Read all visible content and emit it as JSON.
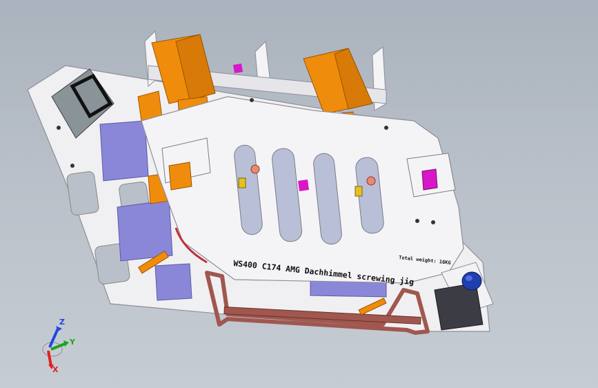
{
  "viewport": {
    "background_top": "#aab2bd",
    "background_bottom": "#c6ccd3"
  },
  "model": {
    "engraving_title": "WS400 C174 AMG Dachhimmel screwing jig",
    "engraving_weight": "Total weight: 16KG",
    "colors": {
      "plate": "#f2f2f4",
      "plate_edge": "#9a9aa6",
      "pads": "#f08c0c",
      "blocks": "#8b87d8",
      "handle": "#a0574f",
      "accent_magenta": "#d818c8",
      "knob": "#1f3fb0",
      "connector": "#8a9498"
    }
  },
  "triad": {
    "x_label": "X",
    "y_label": "Y",
    "z_label": "Z",
    "x_color": "#e0201c",
    "y_color": "#1aa51a",
    "z_color": "#2046e0"
  }
}
